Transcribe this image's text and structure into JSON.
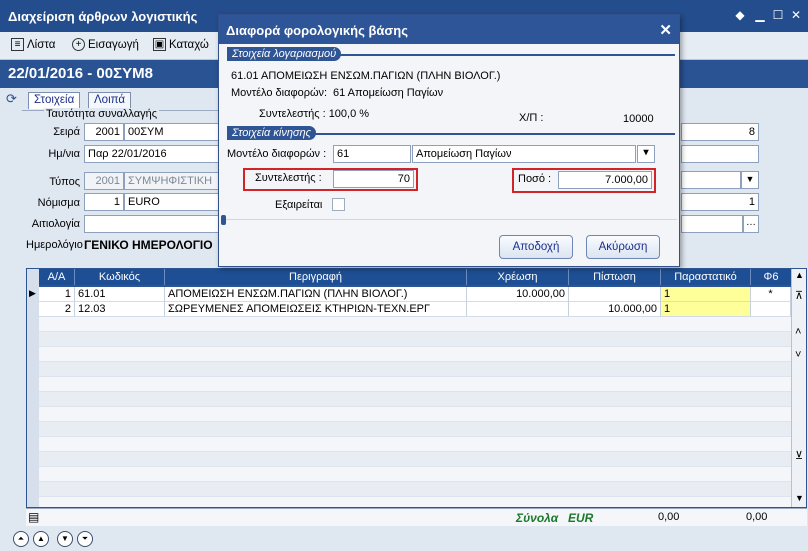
{
  "window": {
    "title": "Διαχείριση άρθρων λογιστικής",
    "toolbar": {
      "list": "Λίστα",
      "insert": "Εισαγωγή",
      "save": "Καταχώ"
    }
  },
  "document": {
    "header": "22/01/2016 - 00ΣΥΜ8"
  },
  "tabs": [
    "Στοιχεία",
    "Λοιπά"
  ],
  "form": {
    "identity_label": "Ταυτότητα συναλλαγής",
    "series_label": "Σειρά",
    "series_code": "2001",
    "series_value": "00ΣΥΜ",
    "series_right_value": "8",
    "date_label": "Ημ/νια",
    "date_value": "Παρ 22/01/2016",
    "type_label": "Τύπος",
    "type_code": "2001",
    "type_value": "ΣΥΜΨΗΦΙΣΤΙΚΗ",
    "currency_label": "Νόμισμα",
    "currency_code": "1",
    "currency_value": "EURO",
    "currency_right_value": "1",
    "reason_label": "Αιτιολογία",
    "journal_label": "Ημερολόγιο",
    "journal_value": "ΓΕΝΙΚΟ ΗΜΕΡΟΛΟΓΙΟ"
  },
  "grid": {
    "columns": [
      "Α/Α",
      "Κωδικός",
      "Περιγραφή",
      "Χρέωση",
      "Πίστωση",
      "Παραστατικό",
      "Φ6"
    ],
    "rows": [
      {
        "aa": "1",
        "code": "61.01",
        "desc": "ΑΠΟΜΕΙΩΣΗ ΕΝΣΩΜ.ΠΑΓΙΩΝ (ΠΛΗΝ ΒΙΟΛΟΓ.)",
        "debit": "10.000,00",
        "credit": "",
        "doc": "1",
        "f6": "*"
      },
      {
        "aa": "2",
        "code": "12.03",
        "desc": "ΣΩΡΕΥΜΕΝΕΣ ΑΠΟΜΕΙΩΣΕΙΣ ΚΤΗΡΙΩΝ-ΤΕΧΝ.ΕΡΓ",
        "debit": "",
        "credit": "10.000,00",
        "doc": "1",
        "f6": ""
      }
    ],
    "totals_label": "Σύνολα",
    "totals_currency": "EUR",
    "total_debit": "0,00",
    "total_credit": "0,00"
  },
  "dialog": {
    "title": "Διαφορά φορολογικής βάσης",
    "section_account": "Στοιχεία λογαριασμού",
    "account_line": "61.01  ΑΠΟΜΕΙΩΣΗ ΕΝΣΩΜ.ΠΑΓΙΩΝ (ΠΛΗΝ ΒΙΟΛΟΓ.)",
    "model_line_label": "Μοντέλο διαφορών:",
    "model_line_value": "61  Απομείωση Παγίων",
    "coef_line": "Συντελεστής : 100,0 %",
    "xp_label": "Χ/Π :",
    "xp_value": "10000",
    "section_movement": "Στοιχεία κίνησης",
    "model_label": "Μοντέλο διαφορών :",
    "model_code": "61",
    "model_name": "Απομείωση Παγίων",
    "coef_label": "Συντελεστής :",
    "coef_value": "70",
    "amount_label": "Ποσό :",
    "amount_value": "7.000,00",
    "excluded_label": "Εξαιρείται",
    "ok_label": "Αποδοχή",
    "cancel_label": "Ακύρωση"
  },
  "colors": {
    "title_bar": "#244d8e",
    "grid_header": "#1e4e93",
    "highlight_box": "#d22426",
    "doc_cell": "#ffff99"
  }
}
